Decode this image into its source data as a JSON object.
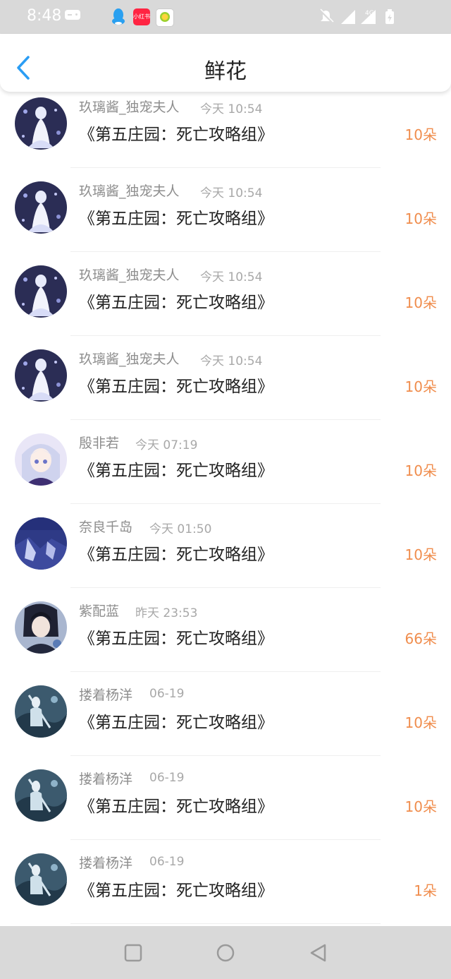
{
  "status_bar": {
    "time": "8:48",
    "xhs_label": "小红书",
    "network": "4G",
    "icons": [
      "gamepad-icon",
      "qq-icon",
      "xiaohongshu-icon",
      "app-icon",
      "mute-icon",
      "signal-icon",
      "battery-icon"
    ]
  },
  "header": {
    "title": "鲜花",
    "back_icon": "chevron-left-icon",
    "accent": "#2a9df4"
  },
  "colors": {
    "amount": "#f08d4d",
    "username": "#8e8e8e",
    "time": "#a8a8a8"
  },
  "records": [
    {
      "user": "玖璃酱_独宠夫人",
      "time": "今天 10:54",
      "book": "《第五庄园：死亡攻略组》",
      "amount": "10朵"
    },
    {
      "user": "玖璃酱_独宠夫人",
      "time": "今天 10:54",
      "book": "《第五庄园：死亡攻略组》",
      "amount": "10朵"
    },
    {
      "user": "玖璃酱_独宠夫人",
      "time": "今天 10:54",
      "book": "《第五庄园：死亡攻略组》",
      "amount": "10朵"
    },
    {
      "user": "玖璃酱_独宠夫人",
      "time": "今天 10:54",
      "book": "《第五庄园：死亡攻略组》",
      "amount": "10朵"
    },
    {
      "user": "殷非若",
      "time": "今天 07:19",
      "book": "《第五庄园：死亡攻略组》",
      "amount": "10朵"
    },
    {
      "user": "奈良千岛",
      "time": "今天 01:50",
      "book": "《第五庄园：死亡攻略组》",
      "amount": "10朵"
    },
    {
      "user": "紫配蓝",
      "time": "昨天 23:53",
      "book": "《第五庄园：死亡攻略组》",
      "amount": "66朵"
    },
    {
      "user": "搂着杨洋",
      "time": "06-19",
      "book": "《第五庄园：死亡攻略组》",
      "amount": "10朵"
    },
    {
      "user": "搂着杨洋",
      "time": "06-19",
      "book": "《第五庄园：死亡攻略组》",
      "amount": "10朵"
    },
    {
      "user": "搂着杨洋",
      "time": "06-19",
      "book": "《第五庄园：死亡攻略组》",
      "amount": "1朵"
    }
  ],
  "nav_bar": {
    "icons": [
      "recents-square-icon",
      "home-circle-icon",
      "back-triangle-icon"
    ]
  }
}
